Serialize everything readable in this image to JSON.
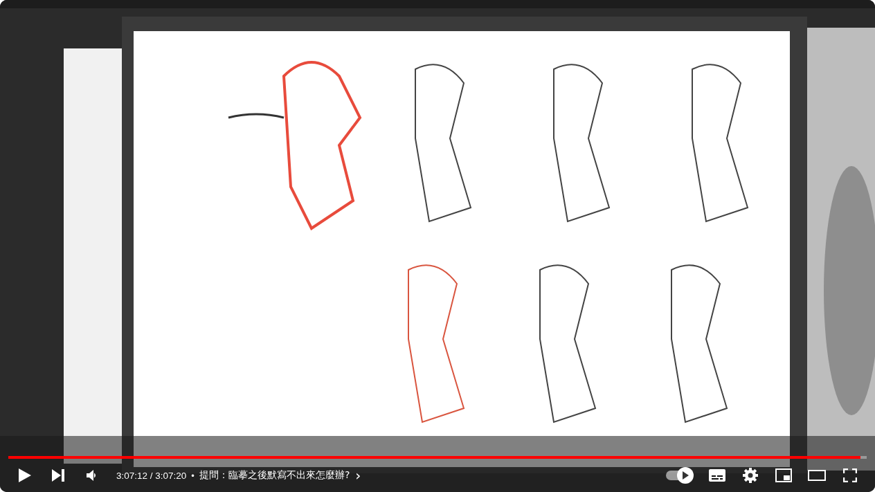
{
  "progress": {
    "level": 0.993
  },
  "controls": {
    "time": "3:07:12 / 3:07:20",
    "separator": "•",
    "chapter": "提問：臨摹之後默寫不出來怎麼辦?",
    "chapter_arrow": "›",
    "autoplay_on": true
  }
}
